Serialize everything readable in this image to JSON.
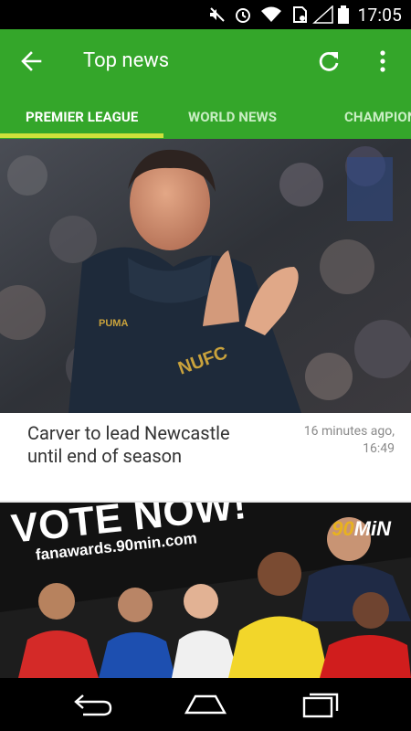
{
  "status_bar": {
    "time": "17:05",
    "icons": [
      "mute-icon",
      "alarm-icon",
      "wifi-icon",
      "sim-icon",
      "signal-icon",
      "battery-icon"
    ]
  },
  "app_bar": {
    "title": "Top news",
    "back_icon": "arrow-left-icon",
    "refresh_icon": "refresh-icon",
    "overflow_icon": "more-vertical-icon",
    "color": "#34a62a"
  },
  "tabs": [
    {
      "label": "PREMIER LEAGUE",
      "active": true
    },
    {
      "label": "WORLD NEWS",
      "active": false
    },
    {
      "label": "CHAMPIONS",
      "active": false
    }
  ],
  "tab_indicator_color": "#cde13b",
  "article": {
    "headline": "Carver to lead Newcastle until end of season",
    "time_ago": "16 minutes ago,",
    "time": "16:49",
    "image": "manager-clapping-photo"
  },
  "ad_banner": {
    "headline": "VOTE NOW!",
    "url": "fanawards.90min.com",
    "logo_number": "90",
    "logo_text": "MiN"
  },
  "nav_bar": {
    "icons": [
      "back-icon",
      "home-icon",
      "recents-icon"
    ]
  }
}
